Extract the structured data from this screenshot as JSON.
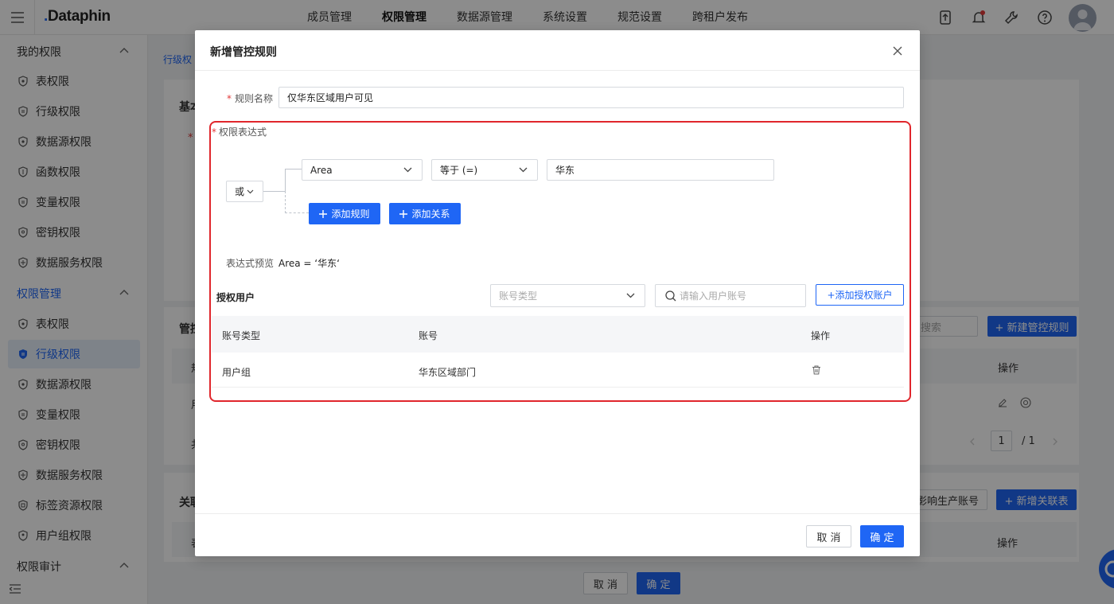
{
  "app": {
    "logo": "Dataphin"
  },
  "topnav": [
    "成员管理",
    "权限管理",
    "数据源管理",
    "系统设置",
    "规范设置",
    "跨租户发布"
  ],
  "topnav_active": 1,
  "sidebar": {
    "group1": "我的权限",
    "group1_items": [
      "表权限",
      "行级权限",
      "数据源权限",
      "函数权限",
      "变量权限",
      "密钥权限",
      "数据服务权限"
    ],
    "group2": "权限管理",
    "group2_items": [
      "表权限",
      "行级权限",
      "数据源权限",
      "变量权限",
      "密钥权限",
      "数据服务权限",
      "标签资源权限",
      "用户组权限"
    ],
    "group2_active_index": 1,
    "group3": "权限审计"
  },
  "background": {
    "breadcrumb": "行级权",
    "section_basic": "基本",
    "section_control": "管控",
    "section_related": "关联",
    "search_placeholder": "搜索",
    "new_rule_button": "+ 新建管控规则",
    "op_header": "操作",
    "page_current": "1",
    "page_total": "/ 1",
    "affect_prod_button": "影响生产账号",
    "new_related_button": "+ 新增关联表",
    "op_header2": "操作",
    "cancel": "取 消",
    "confirm": "确 定",
    "row_col1": "規",
    "row_col2": "用",
    "row_col3": "共",
    "row_col4": "表"
  },
  "modal": {
    "title": "新增管控规则",
    "rule_name_label": "规则名称",
    "rule_name_value": "仅华东区域用户可见",
    "expression_label": "权限表达式",
    "logic_op": "或",
    "field_select": "Area",
    "operator_select": "等于 (=)",
    "value_input": "华东",
    "add_rule_button": "添加规则",
    "add_relation_button": "添加关系",
    "preview_label": "表达式预览",
    "preview_value": "Area = ‘华东‘",
    "auth_users_title": "授权用户",
    "account_type_placeholder": "账号类型",
    "search_placeholder": "请输入用户账号",
    "add_account_button": "+添加授权账户",
    "table_headers": [
      "账号类型",
      "账号",
      "操作"
    ],
    "table_rows": [
      {
        "type": "用户组",
        "account": "华东区域部门"
      }
    ],
    "cancel_button": "取 消",
    "confirm_button": "确 定"
  }
}
